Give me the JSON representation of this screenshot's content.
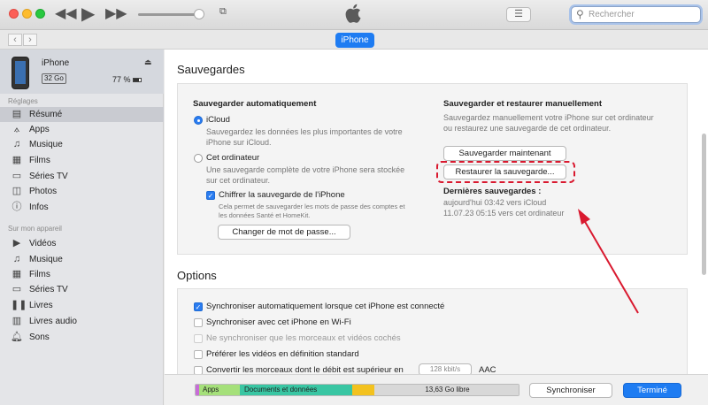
{
  "search": {
    "placeholder": "Rechercher"
  },
  "nav": {
    "device_tab": "iPhone"
  },
  "device": {
    "name": "iPhone",
    "capacity": "32 Go",
    "battery": "77 %"
  },
  "sidebar": {
    "section_settings": "Réglages",
    "settings": [
      {
        "label": "Résumé",
        "icon": "summary-icon"
      },
      {
        "label": "Apps",
        "icon": "apps-icon"
      },
      {
        "label": "Musique",
        "icon": "music-icon"
      },
      {
        "label": "Films",
        "icon": "film-icon"
      },
      {
        "label": "Séries TV",
        "icon": "tv-icon"
      },
      {
        "label": "Photos",
        "icon": "photos-icon"
      },
      {
        "label": "Infos",
        "icon": "info-icon"
      }
    ],
    "section_device": "Sur mon appareil",
    "device": [
      {
        "label": "Vidéos",
        "icon": "video-icon"
      },
      {
        "label": "Musique",
        "icon": "music-icon"
      },
      {
        "label": "Films",
        "icon": "film-icon"
      },
      {
        "label": "Séries TV",
        "icon": "tv-icon"
      },
      {
        "label": "Livres",
        "icon": "book-icon"
      },
      {
        "label": "Livres audio",
        "icon": "audiobook-icon"
      },
      {
        "label": "Sons",
        "icon": "bell-icon"
      }
    ]
  },
  "backups": {
    "title": "Sauvegardes",
    "auto_title": "Sauvegarder automatiquement",
    "icloud_label": "iCloud",
    "icloud_desc_1": "Sauvegardez les données les plus importantes de votre",
    "icloud_desc_2": "iPhone sur iCloud.",
    "computer_label": "Cet ordinateur",
    "computer_desc_1": "Une sauvegarde complète de votre iPhone sera stockée",
    "computer_desc_2": "sur cet ordinateur.",
    "encrypt_label": "Chiffrer la sauvegarde de l'iPhone",
    "encrypt_desc_1": "Cela permet de sauvegarder les mots de passe des comptes et",
    "encrypt_desc_2": "les données Santé et HomeKit.",
    "change_password": "Changer de mot de passe...",
    "manual_title": "Sauvegarder et restaurer manuellement",
    "manual_desc_1": "Sauvegardez manuellement votre iPhone sur cet ordinateur",
    "manual_desc_2": "ou restaurez une sauvegarde de cet ordinateur.",
    "backup_now": "Sauvegarder maintenant",
    "restore": "Restaurer la sauvegarde...",
    "last_title": "Dernières sauvegardes :",
    "last_1": "aujourd'hui 03:42 vers iCloud",
    "last_2": "11.07.23 05:15 vers cet ordinateur"
  },
  "options": {
    "title": "Options",
    "items": [
      {
        "label": "Synchroniser automatiquement lorsque cet iPhone est connecté",
        "checked": true
      },
      {
        "label": "Synchroniser avec cet iPhone en Wi-Fi",
        "checked": false
      },
      {
        "label": "Ne synchroniser que les morceaux et vidéos cochés",
        "checked": false
      },
      {
        "label": "Préférer les vidéos en définition standard",
        "checked": false
      },
      {
        "label": "Convertir les morceaux dont le débit est supérieur en",
        "checked": false
      }
    ],
    "bitrate": "128 kbit/s",
    "aac": "AAC"
  },
  "storage": {
    "apps": "Apps",
    "docs": "Documents et données",
    "free": "13,63 Go libre",
    "colors": {
      "apps": "#a5e07a",
      "docs": "#39c6a3",
      "other": "#f3c21f",
      "free": "#d8d8d8"
    }
  },
  "footer": {
    "sync": "Synchroniser",
    "done": "Terminé"
  },
  "accent": "#1e7cf2",
  "annotation_color": "#d9192f"
}
